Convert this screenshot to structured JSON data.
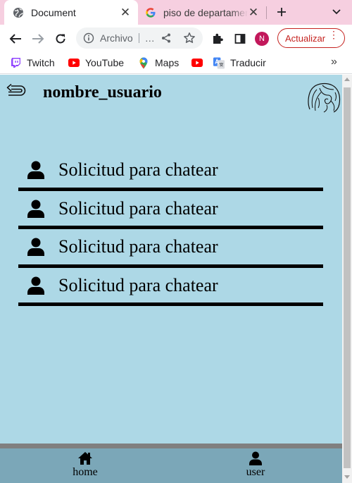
{
  "browser": {
    "tabs": [
      {
        "title": "Document",
        "active": true,
        "favicon": "globe-icon"
      },
      {
        "title": "piso de departamento",
        "active": false,
        "favicon": "google-g-icon"
      }
    ],
    "omnibox": {
      "scheme_label": "Archivo",
      "url_text": "…"
    },
    "profile_initial": "N",
    "update_label": "Actualizar",
    "bookmarks": [
      {
        "label": "Twitch",
        "icon": "twitch-icon"
      },
      {
        "label": "YouTube",
        "icon": "youtube-icon"
      },
      {
        "label": "Maps",
        "icon": "maps-pin-icon"
      },
      {
        "label": "",
        "icon": "youtube-icon"
      },
      {
        "label": "Traducir",
        "icon": "translate-icon"
      }
    ],
    "bookmarks_more": "»"
  },
  "page": {
    "username": "nombre_usuario",
    "requests": [
      {
        "label": "Solicitud para chatear"
      },
      {
        "label": "Solicitud para chatear"
      },
      {
        "label": "Solicitud para chatear"
      },
      {
        "label": "Solicitud para chatear"
      }
    ],
    "nav": {
      "home_label": "home",
      "user_label": "user"
    }
  },
  "colors": {
    "page_bg": "#add8e6",
    "footer_bg": "#7ba7b8",
    "footer_border": "#808080",
    "tabstrip_bg": "#f6cfe0",
    "update_accent": "#c5221f"
  }
}
